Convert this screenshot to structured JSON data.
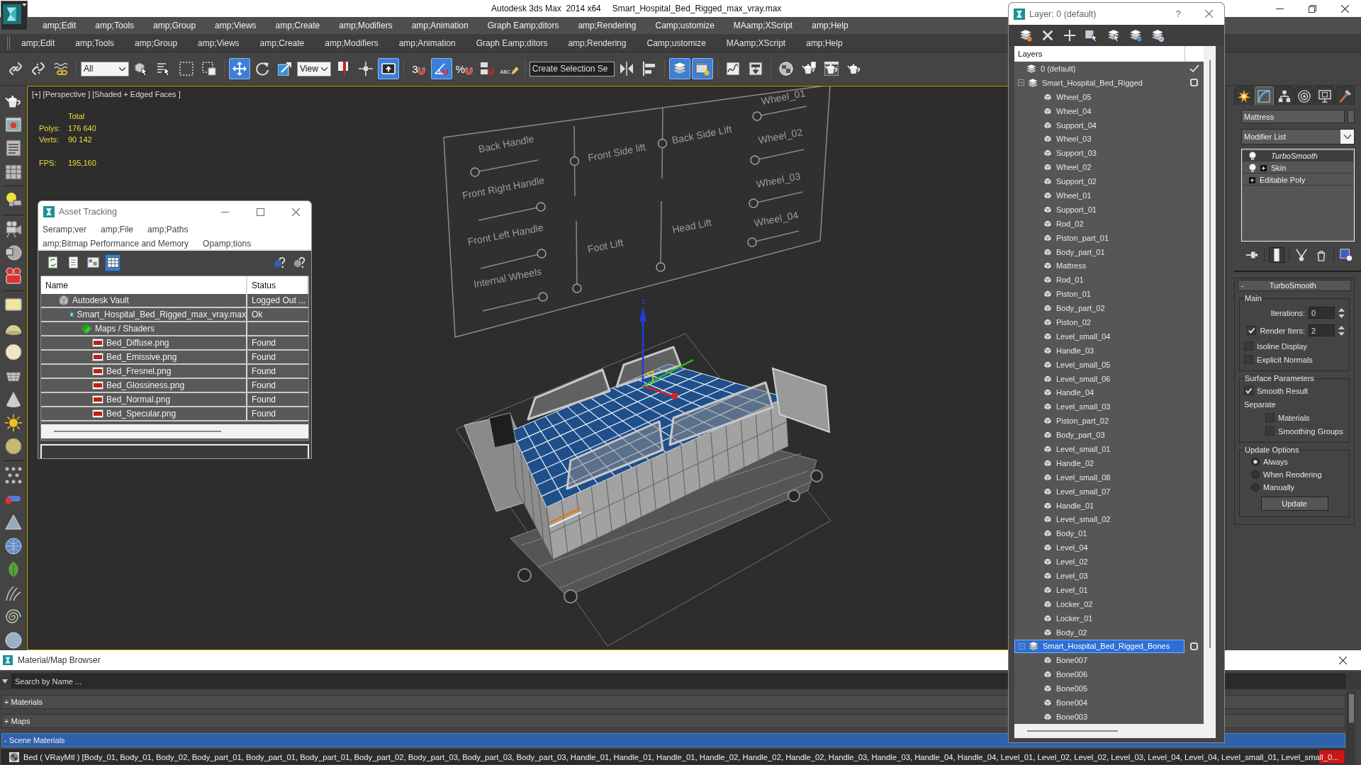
{
  "window": {
    "app_title": "Autodesk 3ds Max  2014 x64",
    "file_title": "Smart_Hospital_Bed_Rigged_max_vray.max"
  },
  "menu_bar": [
    "amp;Edit",
    "amp;Tools",
    "amp;Group",
    "amp;Views",
    "amp;Create",
    "amp;Modifiers",
    "amp;Animation",
    "Graph Eamp;ditors",
    "amp;Rendering",
    "Camp;ustomize",
    "MAamp;XScript",
    "amp;Help"
  ],
  "menu_bar_2": [
    "amp;Edit",
    "amp;Tools",
    "amp;Group",
    "amp;Views",
    "amp;Create",
    "amp;Modifiers",
    "amp;Animation",
    "Graph Eamp;ditors",
    "amp;Rendering",
    "Camp;ustomize",
    "MAamp;XScript",
    "amp;Help"
  ],
  "main_toolbar": [
    {
      "kind": "button",
      "on": false
    },
    {
      "kind": "button",
      "on": false
    },
    {
      "kind": "button",
      "on": false
    },
    {
      "kind": "dropdown",
      "value": "All"
    },
    {
      "kind": "button",
      "on": false
    },
    {
      "kind": "button",
      "on": false
    },
    {
      "kind": "button",
      "on": false
    },
    {
      "kind": "button",
      "on": false
    },
    {
      "kind": "button",
      "on": true
    },
    {
      "kind": "button",
      "on": false
    },
    {
      "kind": "button",
      "on": false
    },
    {
      "kind": "dropdown",
      "value": "View"
    },
    {
      "kind": "button",
      "on": false
    },
    {
      "kind": "button",
      "on": false
    },
    {
      "kind": "button",
      "on": true
    },
    {
      "kind": "button",
      "on": false,
      "glyph": "3"
    },
    {
      "kind": "button",
      "on": true
    },
    {
      "kind": "button",
      "on": false,
      "glyph": "%"
    },
    {
      "kind": "button",
      "on": false
    },
    {
      "kind": "button",
      "on": false,
      "glyph": "ABC"
    },
    {
      "kind": "dropdown",
      "value": "Create Selection Se"
    },
    {
      "kind": "button",
      "on": false
    },
    {
      "kind": "button",
      "on": false
    },
    {
      "kind": "button",
      "on": true
    },
    {
      "kind": "button",
      "on": true
    },
    {
      "kind": "button",
      "on": false
    },
    {
      "kind": "button",
      "on": false
    },
    {
      "kind": "button",
      "on": false
    },
    {
      "kind": "button",
      "on": false
    },
    {
      "kind": "button",
      "on": false
    },
    {
      "kind": "button",
      "on": false
    }
  ],
  "viewport": {
    "label": "[+] [Perspective ] [Shaded + Edged Faces ]",
    "stats_header": "Total",
    "stats": [
      {
        "label": "Polys:",
        "value": "176 640"
      },
      {
        "label": "Verts:",
        "value": "90 142"
      }
    ],
    "fps": {
      "label": "FPS:",
      "value": "195,160"
    },
    "board_controls": [
      {
        "label": "Back Handle",
        "level": 0
      },
      {
        "label": "Front Side lift",
        "level": 0.5
      },
      {
        "label": "Back Side Lift",
        "level": 0.5
      },
      {
        "label": "Wheel_01",
        "level": 0
      },
      {
        "label": "Wheel_02",
        "level": 0
      },
      {
        "label": "Front Right Handle",
        "level": 1
      },
      {
        "label": "Wheel_03",
        "level": 0
      },
      {
        "label": "Front Left Handle",
        "level": 1
      },
      {
        "label": "Foot Lift",
        "level": 0
      },
      {
        "label": "Head Lift",
        "level": 0
      },
      {
        "label": "Wheel_04",
        "level": 0
      },
      {
        "label": "Internal Wheels",
        "level": 1
      }
    ],
    "gizmo_axis_label": "z"
  },
  "asset_tracking": {
    "title": "Asset Tracking",
    "menu_rows": [
      [
        "Seramp;ver",
        "amp;File",
        "amp;Paths"
      ],
      [
        "amp;Bitmap Performance and Memory",
        "Opamp;tions"
      ]
    ],
    "view_buttons": [
      {
        "selected": false
      },
      {
        "selected": false
      },
      {
        "selected": false
      },
      {
        "selected": true
      }
    ],
    "columns": [
      "Name",
      "Status"
    ],
    "rows": [
      {
        "kind": "vault",
        "name": "Autodesk Vault",
        "status": "Logged Out ...",
        "children": [
          {
            "kind": "scene",
            "name": "Smart_Hospital_Bed_Rigged_max_vray.max",
            "status": "Ok",
            "children": [
              {
                "kind": "folder",
                "name": "Maps / Shaders",
                "children": [
                  {
                    "kind": "png",
                    "name": "Bed_Diffuse.png",
                    "status": "Found"
                  },
                  {
                    "kind": "png",
                    "name": "Bed_Emissive.png",
                    "status": "Found"
                  },
                  {
                    "kind": "png",
                    "name": "Bed_Fresnel.png",
                    "status": "Found"
                  },
                  {
                    "kind": "png",
                    "name": "Bed_Glossiness.png",
                    "status": "Found"
                  },
                  {
                    "kind": "png",
                    "name": "Bed_Normal.png",
                    "status": "Found"
                  },
                  {
                    "kind": "png",
                    "name": "Bed_Specular.png",
                    "status": "Found"
                  }
                ]
              }
            ]
          }
        ]
      }
    ]
  },
  "layer_manager": {
    "title": "Layer: 0 (default)",
    "help": "?",
    "header": "Layers",
    "layers": [
      {
        "name": "0 (default)",
        "current": true,
        "selected": false
      },
      {
        "name": "Smart_Hospital_Bed_Rigged",
        "current": false,
        "selected": false,
        "expanded": true,
        "children": [
          {
            "name": "Wheel_05"
          },
          {
            "name": "Wheel_04"
          },
          {
            "name": "Support_04"
          },
          {
            "name": "Wheel_03"
          },
          {
            "name": "Support_03"
          },
          {
            "name": "Wheel_02"
          },
          {
            "name": "Support_02"
          },
          {
            "name": "Wheel_01"
          },
          {
            "name": "Support_01"
          },
          {
            "name": "Rod_02"
          },
          {
            "name": "Piston_part_01"
          },
          {
            "name": "Body_part_01"
          },
          {
            "name": "Mattress"
          },
          {
            "name": "Rod_01"
          },
          {
            "name": "Piston_01"
          },
          {
            "name": "Body_part_02"
          },
          {
            "name": "Piston_02"
          },
          {
            "name": "Level_small_04"
          },
          {
            "name": "Handle_03"
          },
          {
            "name": "Level_small_05"
          },
          {
            "name": "Level_small_06"
          },
          {
            "name": "Handle_04"
          },
          {
            "name": "Level_small_03"
          },
          {
            "name": "Piston_part_02"
          },
          {
            "name": "Body_part_03"
          },
          {
            "name": "Level_small_01"
          },
          {
            "name": "Handle_02"
          },
          {
            "name": "Level_small_08"
          },
          {
            "name": "Level_small_07"
          },
          {
            "name": "Handle_01"
          },
          {
            "name": "Level_small_02"
          },
          {
            "name": "Body_01"
          },
          {
            "name": "Level_04"
          },
          {
            "name": "Level_02"
          },
          {
            "name": "Level_03"
          },
          {
            "name": "Level_01"
          },
          {
            "name": "Locker_02"
          },
          {
            "name": "Locker_01"
          },
          {
            "name": "Body_02"
          }
        ]
      },
      {
        "name": "Smart_Hospital_Bed_Rigged_Bones",
        "current": false,
        "selected": true,
        "expanded": true,
        "children": [
          {
            "name": "Bone007"
          },
          {
            "name": "Bone006"
          },
          {
            "name": "Bone005"
          },
          {
            "name": "Bone004"
          },
          {
            "name": "Bone003"
          }
        ]
      }
    ]
  },
  "command_panel": {
    "tabs": [
      {
        "selected": false
      },
      {
        "selected": true
      },
      {
        "selected": false
      },
      {
        "selected": false
      },
      {
        "selected": false
      },
      {
        "selected": false
      }
    ],
    "object_name": "Mattress",
    "modifier_list": "Modifier List",
    "stack": [
      {
        "kind": "modifier",
        "name": "TurboSmooth",
        "selected": true,
        "off_in_viewport": true,
        "expandable": false
      },
      {
        "kind": "modifier",
        "name": "Skin",
        "selected": false,
        "off_in_viewport": false,
        "expandable": true
      },
      {
        "kind": "base",
        "name": "Editable Poly",
        "selected": false,
        "off_in_viewport": false,
        "expandable": true
      }
    ],
    "stack_buttons": [
      {
        "on": false
      },
      {
        "on": true
      },
      {
        "on": false
      },
      {
        "on": false
      },
      {
        "on": false
      }
    ],
    "rollout": {
      "sign": "-",
      "title": "TurboSmooth",
      "groups": [
        {
          "title": "Main",
          "rows": [
            {
              "kind": "spinner",
              "label": "Iterations:",
              "value": "0"
            },
            {
              "kind": "check_spinner",
              "label": "Render Iters:",
              "checked": true,
              "value": "2"
            },
            {
              "kind": "checkbox",
              "label": "Isoline Display",
              "checked": false
            },
            {
              "kind": "checkbox",
              "label": "Explicit Normals",
              "checked": false
            }
          ]
        },
        {
          "title": "Surface Parameters",
          "rows": [
            {
              "kind": "checkbox",
              "label": "Smooth Result",
              "checked": true
            },
            {
              "kind": "label",
              "label": "Separate",
              "children": [
                {
                  "kind": "checkbox",
                  "label": "Materials",
                  "checked": false
                },
                {
                  "kind": "checkbox",
                  "label": "Smoothing Groups",
                  "checked": false
                }
              ]
            }
          ]
        },
        {
          "title": "Update Options",
          "rows": [
            {
              "kind": "radio",
              "label": "Always",
              "selected": true
            },
            {
              "kind": "radio",
              "label": "When Rendering",
              "selected": false
            },
            {
              "kind": "radio",
              "label": "Manually",
              "selected": false
            },
            {
              "kind": "button",
              "label": "Update"
            }
          ]
        }
      ]
    }
  },
  "material_browser": {
    "title": "Material/Map Browser",
    "search_placeholder": "Search by Name ...",
    "groups": [
      {
        "label": "+ Materials",
        "selected": false
      },
      {
        "label": "+ Maps",
        "selected": false
      },
      {
        "label": "- Scene Materials",
        "selected": true
      }
    ],
    "scene_materials": [
      {
        "name": "Bed ( VRayMtl ) [Body_01, Body_01, Body_02, Body_part_01, Body_part_01, Body_part_01, Body_part_02, Body_part_03, Body_part_03, Body_part_03, Handle_01, Handle_01, Handle_01, Handle_02, Handle_02, Handle_02, Handle_03, Handle_03, Handle_04, Handle_04, Level_01, Level_02, Level_02, Level_03, Level_04, Level_04, Level_small_01, Level_small_0..."
      }
    ]
  }
}
